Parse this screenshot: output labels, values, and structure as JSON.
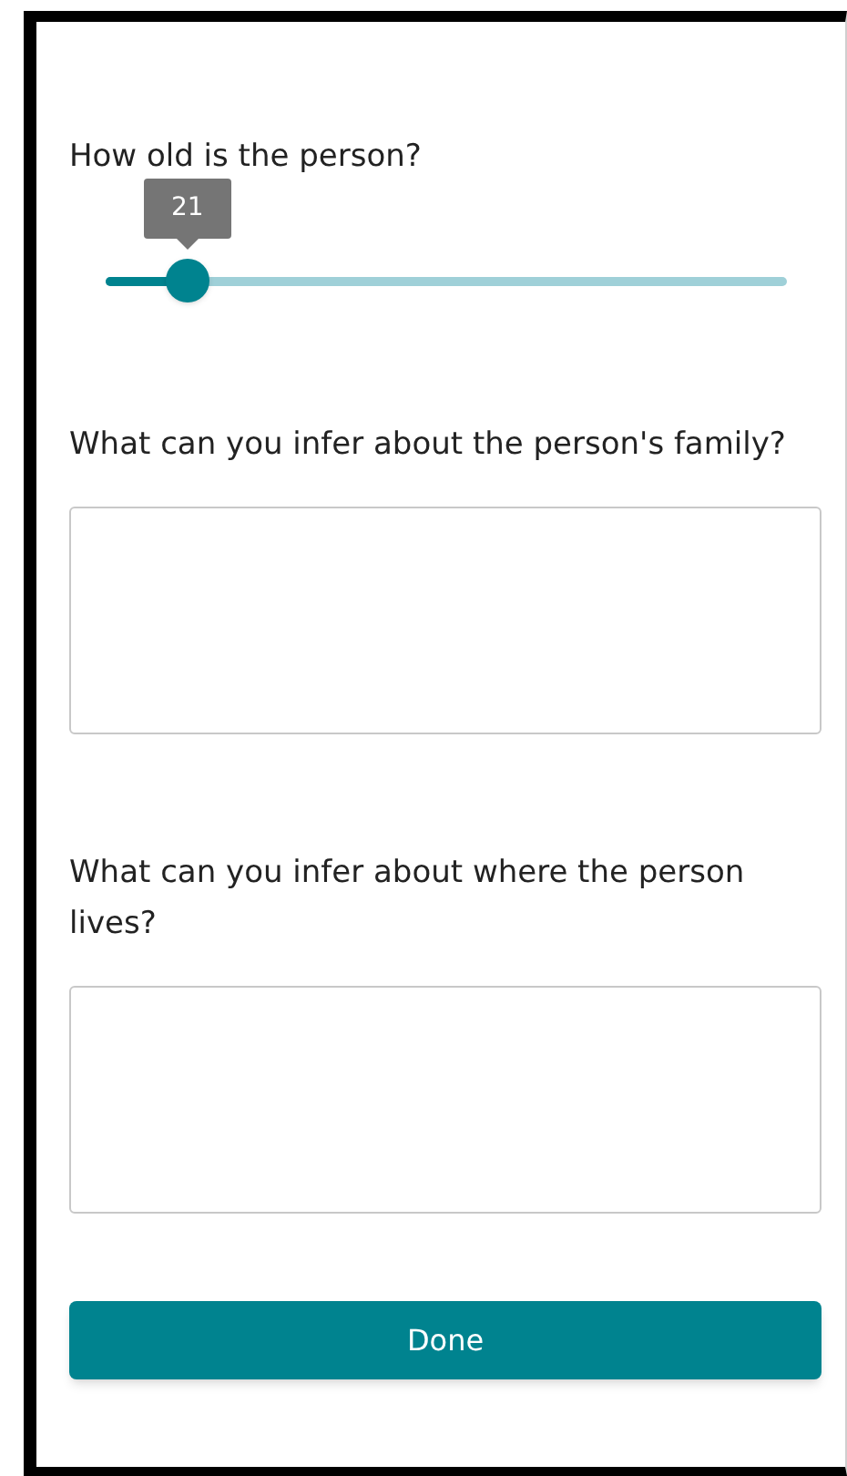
{
  "questions": [
    {
      "kind": "slider",
      "label": "How old is the person?",
      "value": "21",
      "level": 0.12
    },
    {
      "kind": "text",
      "label": "What can you infer about the person's family?"
    },
    {
      "kind": "text",
      "label": "What can you infer about where the person lives?"
    }
  ],
  "done_button": "Done"
}
